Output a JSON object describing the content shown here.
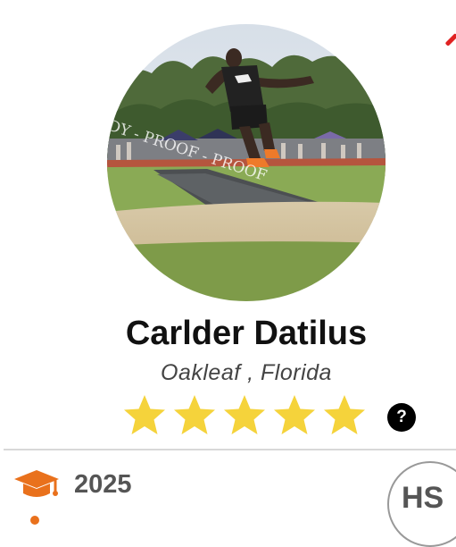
{
  "profile": {
    "name": "Carlder Datilus",
    "location": "Oakleaf , Florida",
    "star_rating": 5,
    "star_max": 5,
    "help_label": "?",
    "graduation_year": "2025",
    "level_badge": "HS",
    "photo_watermark": "DY - PROOF - PROOF"
  },
  "colors": {
    "star": "#f5d33b",
    "accent": "#e9711c",
    "corner_mark": "#e02222"
  },
  "icons": {
    "year": "graduation-cap-icon",
    "help": "question-icon"
  }
}
